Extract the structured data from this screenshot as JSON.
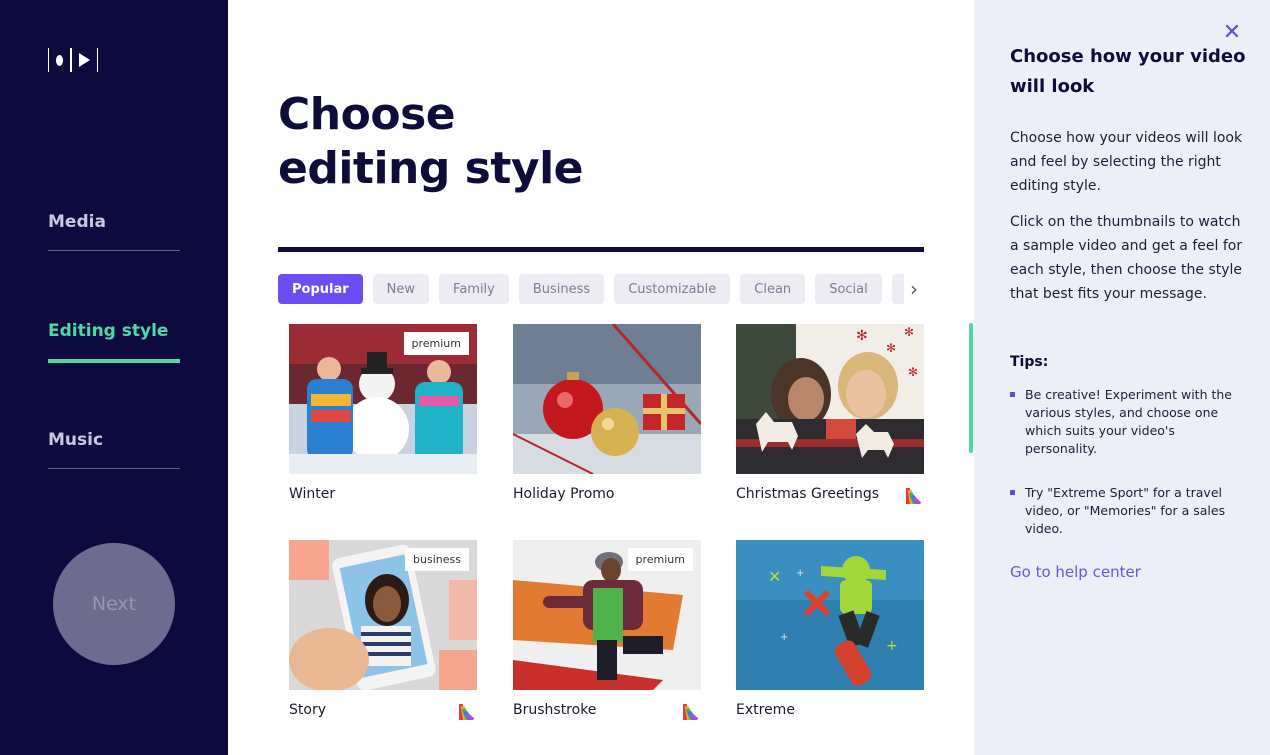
{
  "sidebar": {
    "nav": [
      {
        "label": "Media",
        "active": false
      },
      {
        "label": "Editing style",
        "active": true
      },
      {
        "label": "Music",
        "active": false
      }
    ],
    "next_label": "Next"
  },
  "main": {
    "title_line1": "Choose",
    "title_line2": "editing style",
    "filters": [
      "Popular",
      "New",
      "Family",
      "Business",
      "Customizable",
      "Clean",
      "Social"
    ],
    "active_filter": "Popular",
    "styles": [
      {
        "label": "Winter",
        "badge": "premium",
        "palette_icon": false
      },
      {
        "label": "Holiday Promo",
        "badge": "",
        "palette_icon": false
      },
      {
        "label": "Christmas Greetings",
        "badge": "",
        "palette_icon": true
      },
      {
        "label": "Story",
        "badge": "business",
        "palette_icon": true
      },
      {
        "label": "Brushstroke",
        "badge": "premium",
        "palette_icon": true
      },
      {
        "label": "Extreme",
        "badge": "",
        "palette_icon": false
      }
    ]
  },
  "help": {
    "title": "Choose how your video will look",
    "p1": "Choose how your videos will look and feel by selecting the right editing style.",
    "p2": "Click on the thumbnails to watch a sample video and get a feel for each style, then choose the style that best fits your message.",
    "tips_title": "Tips:",
    "tips": [
      "Be creative! Experiment with the various styles, and choose one which suits your video's personality.",
      "Try \"Extreme Sport\" for a travel video, or \"Memories\" for a sales video."
    ],
    "link": "Go to help center"
  },
  "colors": {
    "sidebar_bg": "#0d0b3e",
    "accent_green": "#4ed8a4",
    "accent_purple": "#6c4df2",
    "panel_bg": "#eceef8"
  }
}
